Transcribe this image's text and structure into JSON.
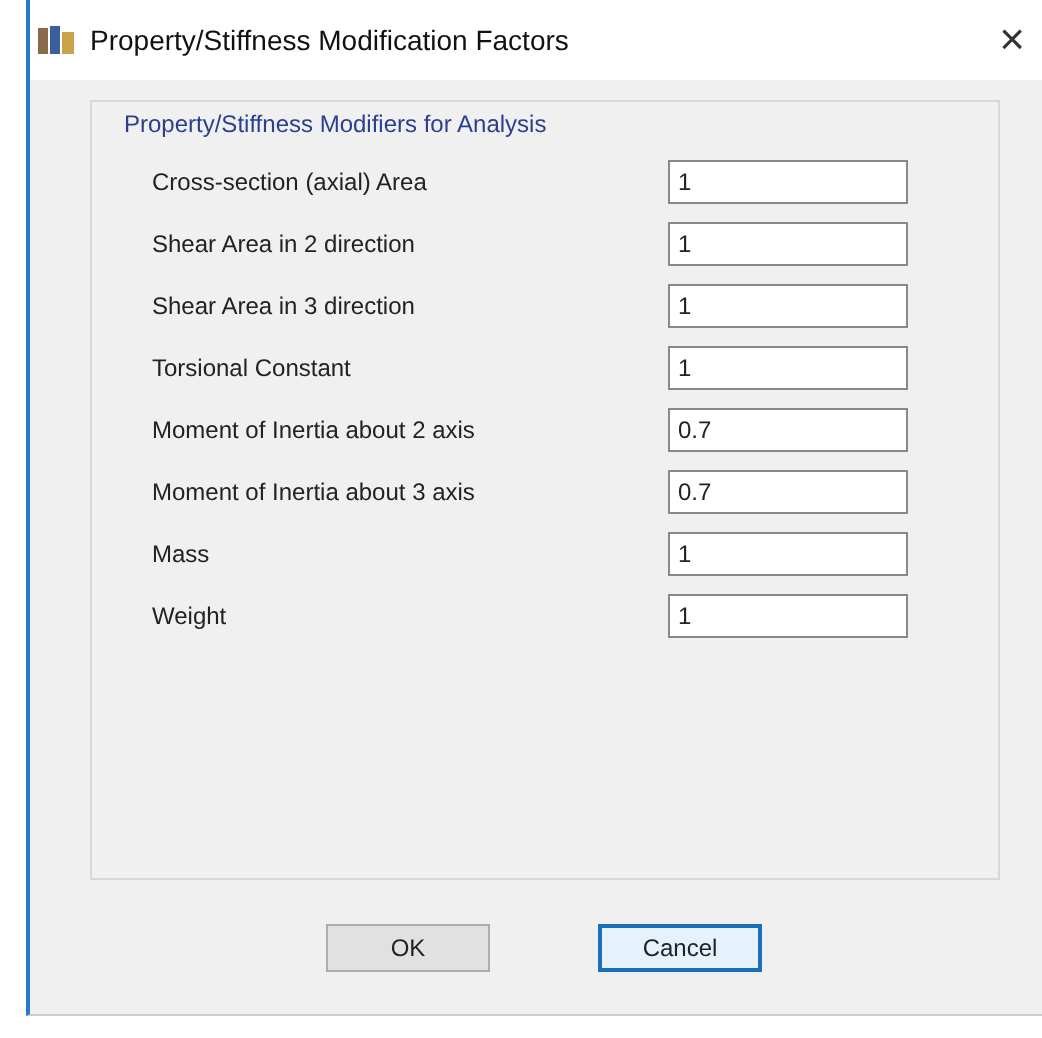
{
  "window": {
    "title": "Property/Stiffness Modification Factors",
    "close": "×"
  },
  "group": {
    "title": "Property/Stiffness Modifiers for Analysis",
    "fields": [
      {
        "label": "Cross-section (axial) Area",
        "value": "1"
      },
      {
        "label": "Shear Area in 2 direction",
        "value": "1"
      },
      {
        "label": "Shear Area in 3 direction",
        "value": "1"
      },
      {
        "label": "Torsional Constant",
        "value": "1"
      },
      {
        "label": "Moment of Inertia about 2 axis",
        "value": "0.7"
      },
      {
        "label": "Moment of Inertia about 3 axis",
        "value": "0.7"
      },
      {
        "label": "Mass",
        "value": "1"
      },
      {
        "label": "Weight",
        "value": "1"
      }
    ]
  },
  "buttons": [
    {
      "label": "OK",
      "focused": false
    },
    {
      "label": "Cancel",
      "focused": true
    }
  ]
}
